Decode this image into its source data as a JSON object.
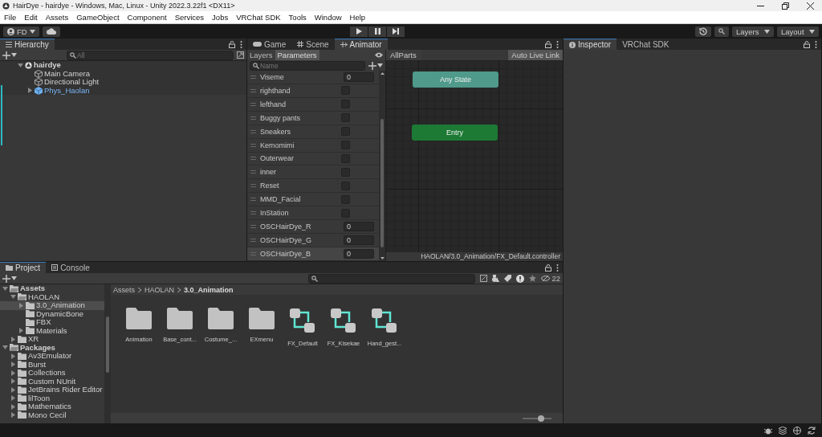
{
  "window": {
    "title": "HairDye - hairdye - Windows, Mac, Linux - Unity 2022.3.22f1 <DX11>"
  },
  "menu": [
    "File",
    "Edit",
    "Assets",
    "GameObject",
    "Component",
    "Services",
    "Jobs",
    "VRChat SDK",
    "Tools",
    "Window",
    "Help"
  ],
  "toolbar": {
    "account": "FD",
    "layers": "Layers",
    "layout": "Layout"
  },
  "hierarchy": {
    "tab": "Hierarchy",
    "search_placeholder": "All",
    "items": [
      {
        "label": "hairdye",
        "kind": "scene",
        "expanded": true,
        "children": [
          {
            "label": "Main Camera",
            "kind": "object"
          },
          {
            "label": "Directional Light",
            "kind": "object"
          },
          {
            "label": "Phys_Haolan",
            "kind": "prefab",
            "expanded": false
          }
        ]
      }
    ]
  },
  "center_tabs": [
    {
      "label": "Game",
      "selected": false
    },
    {
      "label": "Scene",
      "selected": false
    },
    {
      "label": "Animator",
      "selected": true
    }
  ],
  "animator": {
    "subtabs": [
      {
        "label": "Layers",
        "selected": false
      },
      {
        "label": "Parameters",
        "selected": true
      }
    ],
    "search_placeholder": "Name",
    "parameters": [
      {
        "name": "Viseme",
        "kind": "int",
        "value": "0",
        "selected": false
      },
      {
        "name": "righthand",
        "kind": "bool",
        "checked": false,
        "selected": false
      },
      {
        "name": "lefthand",
        "kind": "bool",
        "checked": false,
        "selected": false
      },
      {
        "name": "Buggy pants",
        "kind": "bool",
        "checked": false,
        "selected": false
      },
      {
        "name": "Sneakers",
        "kind": "bool",
        "checked": false,
        "selected": false
      },
      {
        "name": "Kemomimi",
        "kind": "bool",
        "checked": false,
        "selected": false
      },
      {
        "name": "Outerwear",
        "kind": "bool",
        "checked": false,
        "selected": false
      },
      {
        "name": "inner",
        "kind": "bool",
        "checked": false,
        "selected": false
      },
      {
        "name": "Reset",
        "kind": "bool",
        "checked": false,
        "selected": false
      },
      {
        "name": "MMD_Facial",
        "kind": "bool",
        "checked": false,
        "selected": false
      },
      {
        "name": "InStation",
        "kind": "bool",
        "checked": false,
        "selected": false
      },
      {
        "name": "OSCHairDye_R",
        "kind": "int",
        "value": "0",
        "selected": false
      },
      {
        "name": "OSCHairDye_G",
        "kind": "int",
        "value": "0",
        "selected": false
      },
      {
        "name": "OSCHairDye_B",
        "kind": "int",
        "value": "0",
        "selected": true
      }
    ],
    "breadcrumb": "AllParts",
    "live_link": "Auto Live Link",
    "states": [
      {
        "label": "Any State",
        "kind": "any"
      },
      {
        "label": "Entry",
        "kind": "entry"
      }
    ],
    "path": "HAOLAN/3.0_Animation/FX_Default.controller"
  },
  "inspector_tabs": [
    {
      "label": "Inspector",
      "selected": true
    },
    {
      "label": "VRChat SDK",
      "selected": false
    }
  ],
  "project": {
    "tabs": [
      {
        "label": "Project",
        "selected": true
      },
      {
        "label": "Console",
        "selected": false
      }
    ],
    "tree": [
      {
        "label": "Assets",
        "expanded": true,
        "selected": false,
        "children": [
          {
            "label": "HAOLAN",
            "expanded": true,
            "selected": false,
            "children": [
              {
                "label": "3.0_Animation",
                "expanded": false,
                "selected": true
              },
              {
                "label": "DynamicBone",
                "selected": false
              },
              {
                "label": "FBX",
                "selected": false
              },
              {
                "label": "Materials",
                "expanded": false,
                "selected": false
              }
            ]
          },
          {
            "label": "XR",
            "expanded": false,
            "selected": false
          }
        ]
      },
      {
        "label": "Packages",
        "expanded": true,
        "selected": false,
        "children": [
          {
            "label": "Av3Emulator",
            "expanded": false,
            "selected": false
          },
          {
            "label": "Burst",
            "expanded": false,
            "selected": false
          },
          {
            "label": "Collections",
            "expanded": false,
            "selected": false
          },
          {
            "label": "Custom NUnit",
            "expanded": false,
            "selected": false
          },
          {
            "label": "JetBrains Rider Editor",
            "expanded": false,
            "selected": false
          },
          {
            "label": "lilToon",
            "expanded": false,
            "selected": false
          },
          {
            "label": "Mathematics",
            "expanded": false,
            "selected": false
          },
          {
            "label": "Mono Cecil",
            "expanded": false,
            "selected": false
          }
        ]
      }
    ],
    "breadcrumb": [
      "Assets",
      "HAOLAN",
      "3.0_Animation"
    ],
    "hidden_count": "22",
    "assets": [
      {
        "label": "Animation",
        "kind": "folder"
      },
      {
        "label": "Base_cont...",
        "kind": "folder"
      },
      {
        "label": "Costume_...",
        "kind": "folder"
      },
      {
        "label": "EXmenu",
        "kind": "folder"
      },
      {
        "label": "FX_Default",
        "kind": "controller"
      },
      {
        "label": "FX_Kisekae",
        "kind": "controller"
      },
      {
        "label": "Hand_gest...",
        "kind": "controller"
      }
    ],
    "zoom": {
      "level": 0.63
    }
  }
}
